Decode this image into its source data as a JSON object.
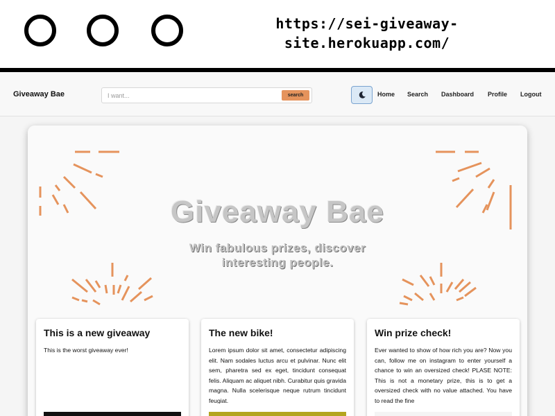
{
  "browser": {
    "window_buttons": [
      "circle",
      "circle",
      "circle"
    ],
    "url_line1": "https://sei-giveaway-",
    "url_line2": "site.herokuapp.com/"
  },
  "navbar": {
    "brand": "Giveaway Bae",
    "search": {
      "placeholder": "I want...",
      "value": "",
      "button_label": "search"
    },
    "theme_toggle_icon": "moon-icon",
    "links": [
      "Home",
      "Search",
      "Dashboard",
      "Profile",
      "Logout"
    ]
  },
  "hero": {
    "title": "Giveaway Bae",
    "subtitle_line1": "Win fabulous prizes, discover",
    "subtitle_line2": "interesting people.",
    "accent_color": "#e5935c"
  },
  "giveaways": [
    {
      "title": "This is a new giveaway",
      "description": "This is the worst giveaway ever!"
    },
    {
      "title": "The new bike!",
      "description": "Lorem ipsum dolor sit amet, consectetur adipiscing elit. Nam sodales luctus arcu et pulvinar. Nunc elit sem, pharetra sed ex eget, tincidunt consequat felis. Aliquam ac aliquet nibh. Curabitur quis gravida magna. Nulla scelerisque neque rutrum tincidunt feugiat."
    },
    {
      "title": "Win prize check!",
      "description": "Ever wanted to show of how rich you are? Now you can, follow me on instagram to enter yourself a chance to win an oversized check! PLASE NOTE: This is not a monetary prize, this is to get a oversized check with no value attached. You have to read the fine"
    }
  ]
}
